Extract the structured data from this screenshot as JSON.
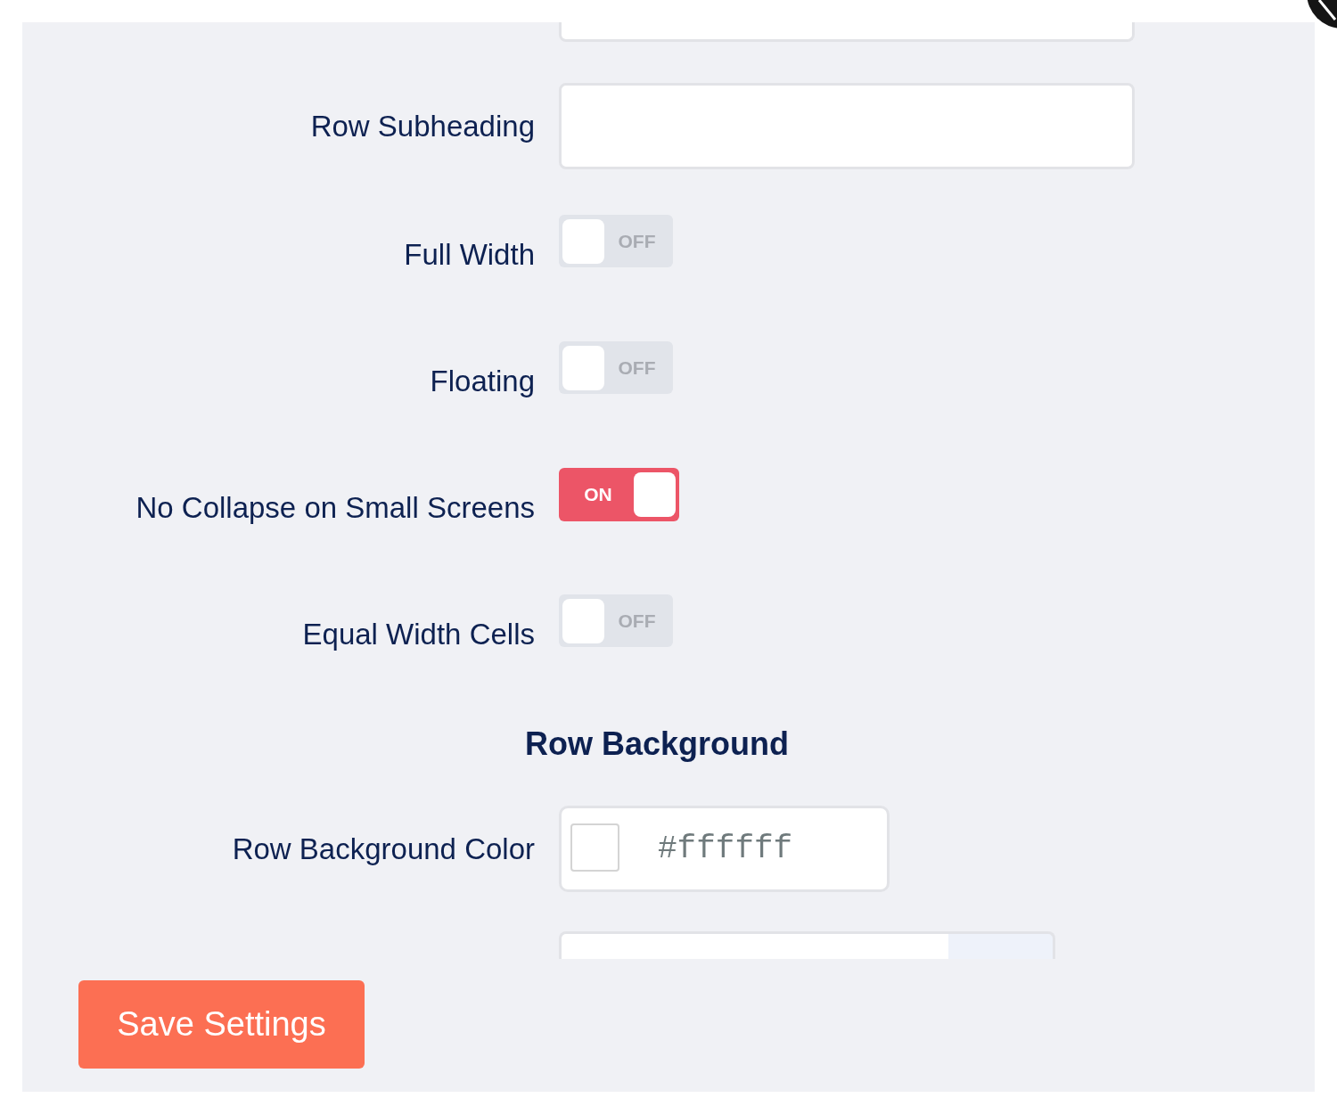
{
  "form": {
    "rows": [
      {
        "kind": "text"
      },
      {
        "kind": "text",
        "label": "Row Subheading"
      },
      {
        "kind": "toggle",
        "label": "Full Width",
        "on": false,
        "text": "OFF"
      },
      {
        "kind": "toggle",
        "label": "Floating",
        "on": false,
        "text": "OFF"
      },
      {
        "kind": "toggle",
        "label": "No Collapse on Small Screens",
        "on": true,
        "text": "ON"
      },
      {
        "kind": "toggle",
        "label": "Equal Width Cells",
        "on": false,
        "text": "OFF"
      },
      {
        "kind": "heading",
        "text": "Row Background"
      },
      {
        "kind": "color",
        "label": "Row Background Color",
        "value": "#ffffff",
        "color": "#ffffff"
      },
      {
        "kind": "addon"
      }
    ]
  },
  "footer": {
    "save_button": "Save Settings"
  }
}
